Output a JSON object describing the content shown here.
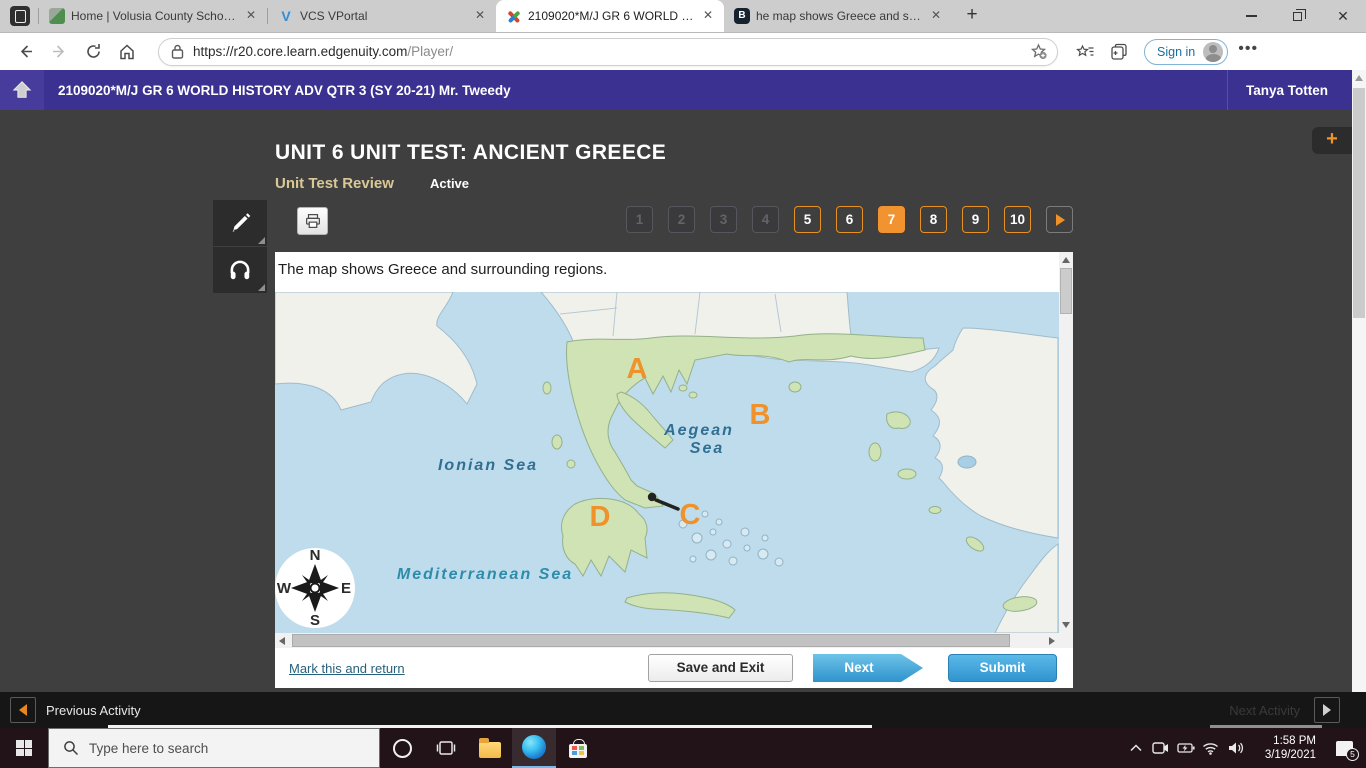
{
  "colors": {
    "accent_orange": "#F0922B",
    "header_purple": "#3B3191",
    "content_gray": "#3F3F3F",
    "button_blue": "#3FA0D4",
    "map_sea": "#BEDCEC",
    "map_land": "#F1F1EC",
    "map_greece": "#CFE3B4"
  },
  "browser": {
    "tabs": [
      {
        "title": "Home | Volusia County Schools"
      },
      {
        "title": "VCS VPortal"
      },
      {
        "title": "2109020*M/J GR 6 WORLD HIST...",
        "active": true
      },
      {
        "title": "he map shows Greece and surro..."
      }
    ],
    "new_tab_glyph": "+",
    "url_domain": "https://r20.core.learn.edgenuity.com",
    "url_path": "/Player/",
    "sign_in_label": "Sign in"
  },
  "course_header": {
    "title": "2109020*M/J GR 6 WORLD HISTORY ADV QTR 3 (SY 20-21) Mr. Tweedy",
    "user_name": "Tanya Totten"
  },
  "test": {
    "title": "UNIT 6 UNIT TEST: ANCIENT GREECE",
    "review_label": "Unit Test Review",
    "status_label": "Active",
    "add_glyph": "+",
    "questions": [
      {
        "label": "1",
        "state": "disabled"
      },
      {
        "label": "2",
        "state": "disabled"
      },
      {
        "label": "3",
        "state": "disabled"
      },
      {
        "label": "4",
        "state": "disabled"
      },
      {
        "label": "5",
        "state": "normal"
      },
      {
        "label": "6",
        "state": "normal"
      },
      {
        "label": "7",
        "state": "current"
      },
      {
        "label": "8",
        "state": "normal"
      },
      {
        "label": "9",
        "state": "normal"
      },
      {
        "label": "10",
        "state": "normal"
      }
    ]
  },
  "question": {
    "prompt": "The map shows Greece and surrounding regions.",
    "map": {
      "markers": [
        {
          "text": "A"
        },
        {
          "text": "B"
        },
        {
          "text": "C"
        },
        {
          "text": "D"
        }
      ],
      "sea_labels": {
        "ionian": "Ionian Sea",
        "aegean_line1": "Aegean",
        "aegean_line2": "Sea",
        "mediterranean": "Mediterranean Sea"
      },
      "compass": {
        "n": "N",
        "e": "E",
        "s": "S",
        "w": "W"
      }
    }
  },
  "footer": {
    "mark_link_label": "Mark this and return",
    "save_exit_label": "Save and Exit",
    "next_label": "Next",
    "submit_label": "Submit"
  },
  "activity_bar": {
    "previous_label": "Previous Activity",
    "next_label": "Next Activity"
  },
  "taskbar": {
    "search_placeholder": "Type here to search",
    "clock_time": "1:58 PM",
    "clock_date": "3/19/2021",
    "notification_count": "5"
  }
}
